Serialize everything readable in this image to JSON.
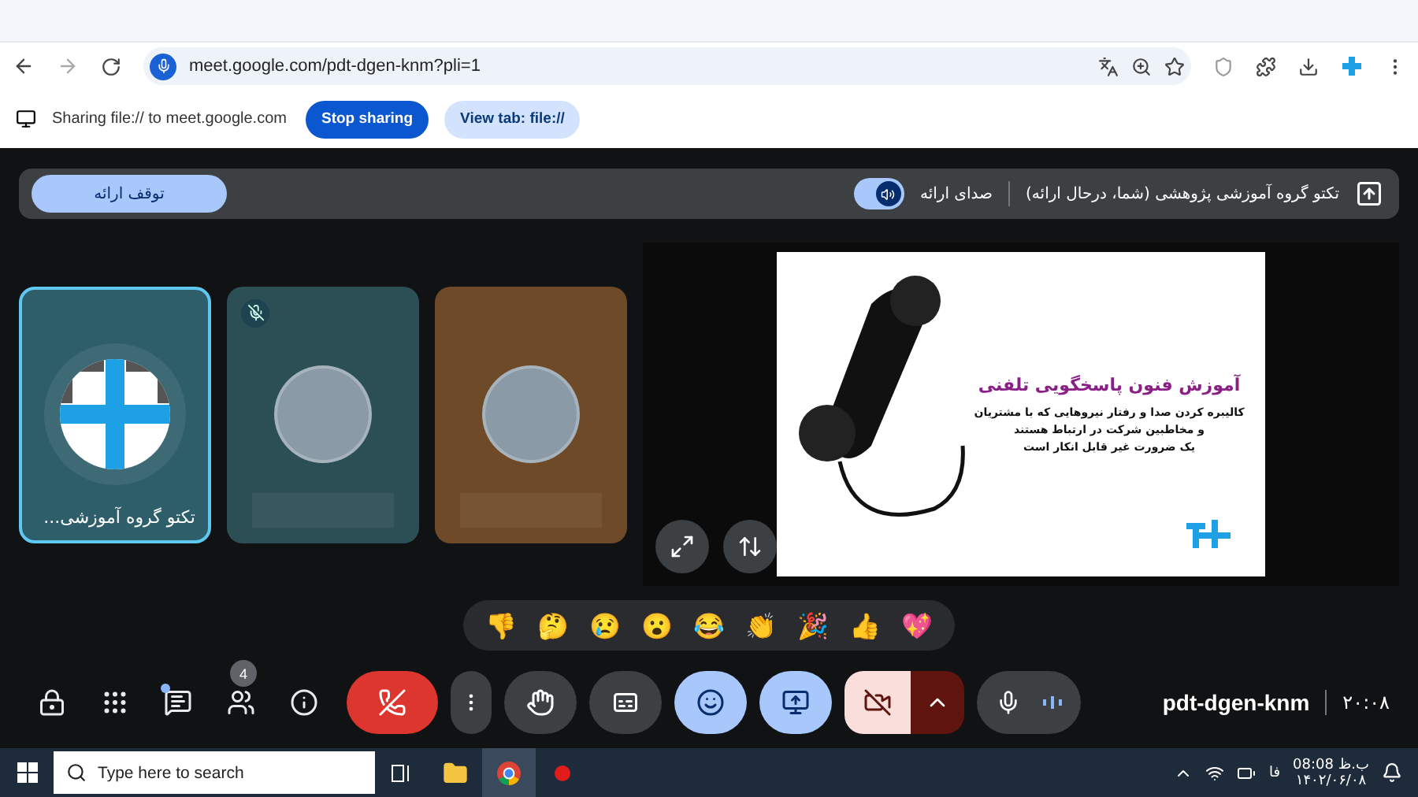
{
  "browser": {
    "url": "meet.google.com/pdt-dgen-knm?pli=1"
  },
  "sharing_bar": {
    "text": "Sharing file:// to meet.google.com",
    "stop_button": "Stop sharing",
    "view_button": "View tab: file://"
  },
  "presenter_bar": {
    "title": "تکتو گروه آموزشی پژوهشی (شما، درحال ارائه)",
    "audio_label": "صدای ارائه",
    "audio_on": true,
    "stop_button": "توقف ارائه"
  },
  "tiles": [
    {
      "kind": "self",
      "name": "تکتو گروه آموزشی...",
      "highlighted": true,
      "muted": false,
      "color": "#2e5e6a"
    },
    {
      "kind": "photo",
      "muted": true,
      "highlighted": false,
      "color": "#2c4e55"
    },
    {
      "kind": "photo",
      "muted": false,
      "highlighted": false,
      "color": "#6e4a28"
    }
  ],
  "slide": {
    "title": "آموزش فنون پاسخگویی تلفنی",
    "lines": [
      "کالیبره کردن صدا و رفتار نیروهایی که با مشتریان",
      "و مخاطبین شرکت در ارتباط هستند",
      "یک ضرورت غیر قابل انکار است"
    ]
  },
  "reactions": [
    "💖",
    "👍",
    "🎉",
    "👏",
    "😂",
    "😮",
    "😢",
    "🤔",
    "👎"
  ],
  "toolbar": {
    "chat_dot": true,
    "people_count": "4",
    "controls": [
      {
        "kind": "leave",
        "active": false
      },
      {
        "kind": "more",
        "active": false
      },
      {
        "kind": "hand",
        "active": false
      },
      {
        "kind": "captions",
        "active": false
      },
      {
        "kind": "emoji",
        "active": true
      },
      {
        "kind": "present",
        "active": true
      },
      {
        "kind": "camera",
        "active": false
      },
      {
        "kind": "mic",
        "active": true
      }
    ],
    "meeting_code": "pdt-dgen-knm",
    "time": "۲۰:۰۸"
  },
  "taskbar": {
    "search_placeholder": "Type here to search",
    "language": "فا",
    "time": "08:08 ب.ظ",
    "date": "۱۴۰۲/۰۶/۰۸"
  }
}
